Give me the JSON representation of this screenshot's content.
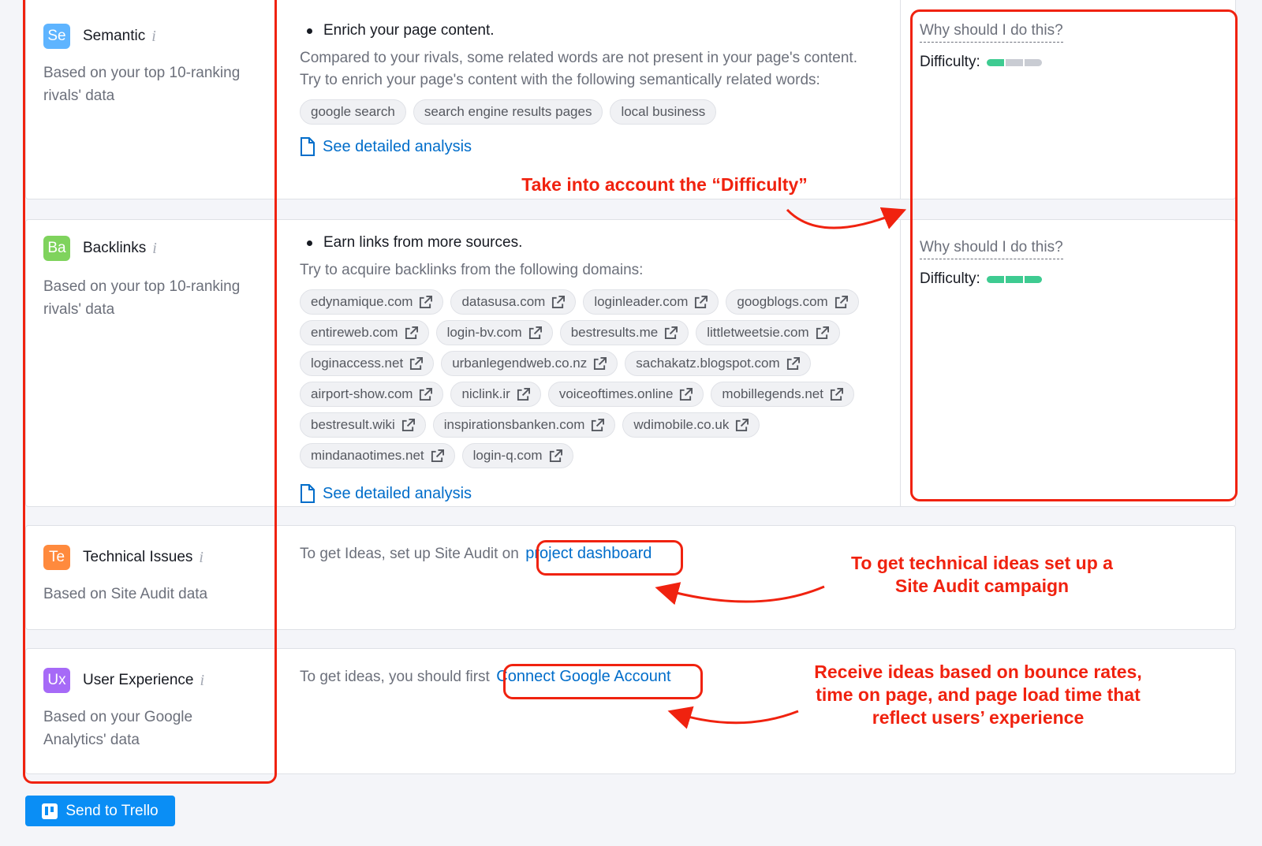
{
  "semantic": {
    "badge": "Se",
    "badge_color": "#5eb4ff",
    "title": "Semantic",
    "info": "i",
    "desc": "Based on your top 10-ranking rivals' data",
    "bullet": "Enrich your page content.",
    "para1": "Compared to your rivals, some related words are not present in your page's content.",
    "para2": "Try to enrich your page's content with the following semantically related words:",
    "chips": [
      "google search",
      "search engine results pages",
      "local business"
    ],
    "link": "See detailed analysis",
    "why": "Why should I do this?",
    "difficulty_label": "Difficulty:",
    "difficulty_level": 1,
    "difficulty_max": 3
  },
  "backlinks": {
    "badge": "Ba",
    "badge_color": "#7fd35d",
    "title": "Backlinks",
    "info": "i",
    "desc": "Based on your top 10-ranking rivals' data",
    "bullet": "Earn links from more sources.",
    "para": "Try to acquire backlinks from the following domains:",
    "domains": [
      "edynamique.com",
      "datasusa.com",
      "loginleader.com",
      "googblogs.com",
      "entireweb.com",
      "login-bv.com",
      "bestresults.me",
      "littletweetsie.com",
      "loginaccess.net",
      "urbanlegendweb.co.nz",
      "sachakatz.blogspot.com",
      "airport-show.com",
      "niclink.ir",
      "voiceoftimes.online",
      "mobillegends.net",
      "bestresult.wiki",
      "inspirationsbanken.com",
      "wdimobile.co.uk",
      "mindanaotimes.net",
      "login-q.com"
    ],
    "link": "See detailed analysis",
    "why": "Why should I do this?",
    "difficulty_label": "Difficulty:",
    "difficulty_level": 3,
    "difficulty_max": 3
  },
  "technical": {
    "badge": "Te",
    "badge_color": "#ff8a3d",
    "title": "Technical Issues",
    "info": "i",
    "desc": "Based on Site Audit data",
    "text": "To get Ideas, set up Site Audit on",
    "link": "project dashboard"
  },
  "ux": {
    "badge": "Ux",
    "badge_color": "#a66af7",
    "title": "User Experience",
    "info": "i",
    "desc": "Based on your Google Analytics' data",
    "text": "To get ideas, you should first",
    "link": "Connect Google Account"
  },
  "annotations": {
    "difficulty": "Take into account the “Difficulty”",
    "technical": "To get technical ideas set up a Site Audit campaign",
    "ux": "Receive ideas based on bounce rates, time on page, and page load time that reflect users’ experience",
    "color": "#f0220f"
  },
  "trello_button": "Send to Trello"
}
